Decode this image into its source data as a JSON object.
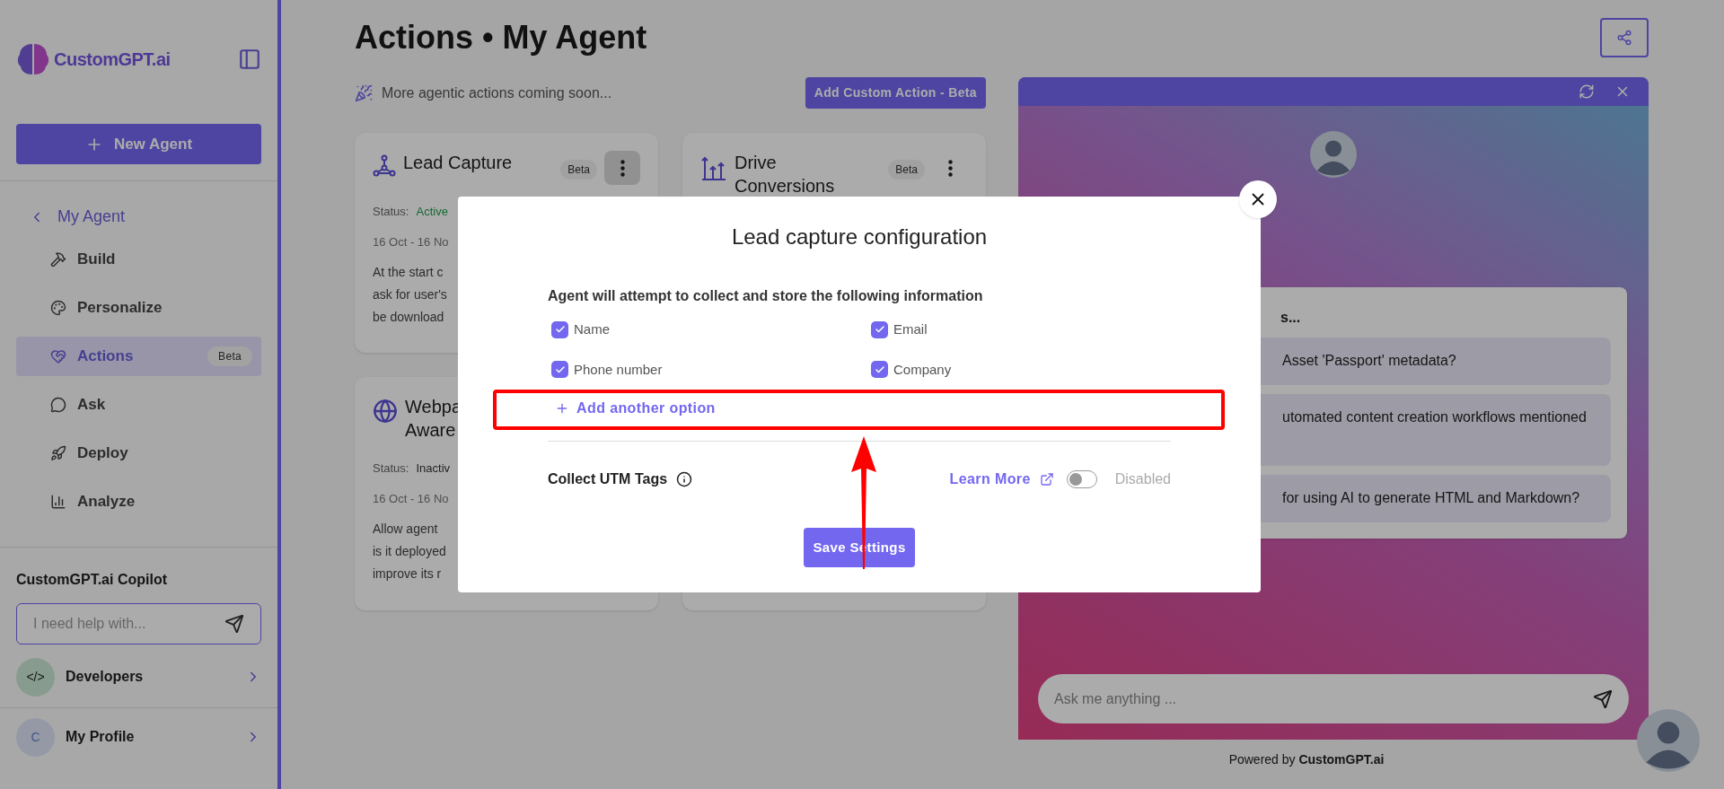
{
  "sidebar": {
    "logo_text": "CustomGPT.ai",
    "new_agent_button": "New Agent",
    "back_link": "My Agent",
    "items": [
      {
        "label": "Build",
        "selected": false
      },
      {
        "label": "Personalize",
        "selected": false
      },
      {
        "label": "Actions",
        "selected": true,
        "badge": "Beta"
      },
      {
        "label": "Ask",
        "selected": false
      },
      {
        "label": "Deploy",
        "selected": false
      },
      {
        "label": "Analyze",
        "selected": false
      }
    ],
    "copilot": {
      "title": "CustomGPT.ai Copilot",
      "placeholder": "I need help with..."
    },
    "links": [
      {
        "label": "Developers",
        "avatar": "</>"
      },
      {
        "label": "My Profile",
        "avatar": "C"
      }
    ]
  },
  "header": {
    "title": "Actions • My Agent"
  },
  "notice": "More agentic actions coming soon...",
  "add_button": "Add Custom Action - Beta",
  "cards": [
    {
      "kind": "action",
      "title": [
        "Lead Capture"
      ],
      "badge": "Beta",
      "menu_open": true,
      "status_label": "Status:",
      "status": "Active",
      "active": true,
      "dates": "16 Oct - 16 No",
      "description": [
        "At the start c",
        "ask for user's",
        "be download"
      ]
    },
    {
      "kind": "action",
      "title": [
        "Drive",
        "Conversions"
      ],
      "badge": "Beta",
      "menu_open": false
    },
    {
      "kind": "action",
      "title": [
        "Webpa",
        "Aware"
      ],
      "status_label": "Status:",
      "status": "Inactiv",
      "active": false,
      "dates": "16 Oct - 16 No",
      "description": [
        "Allow agent",
        "is it deployed",
        "improve its r"
      ]
    },
    {
      "kind": "covered"
    }
  ],
  "modal": {
    "title": "Lead capture configuration",
    "intro": "Agent will attempt to collect and store the following information",
    "fields": [
      {
        "label": "Name",
        "checked": true
      },
      {
        "label": "Email",
        "checked": true
      },
      {
        "label": "Phone number",
        "checked": true
      },
      {
        "label": "Company",
        "checked": true
      }
    ],
    "add_option": "Add another option",
    "utm_label": "Collect UTM Tags",
    "learn_more": "Learn More",
    "utm_enabled": false,
    "utm_state": "Disabled",
    "save_button": "Save Settings"
  },
  "chat": {
    "suggestions_title": "s...",
    "suggestions": [
      "Asset 'Passport' metadata?",
      "utomated content creation workflows mentioned",
      "for using AI to generate HTML and Markdown?"
    ],
    "input_placeholder": "Ask me anything ...",
    "powered_by": "Powered by **CustomGPT.ai**"
  }
}
